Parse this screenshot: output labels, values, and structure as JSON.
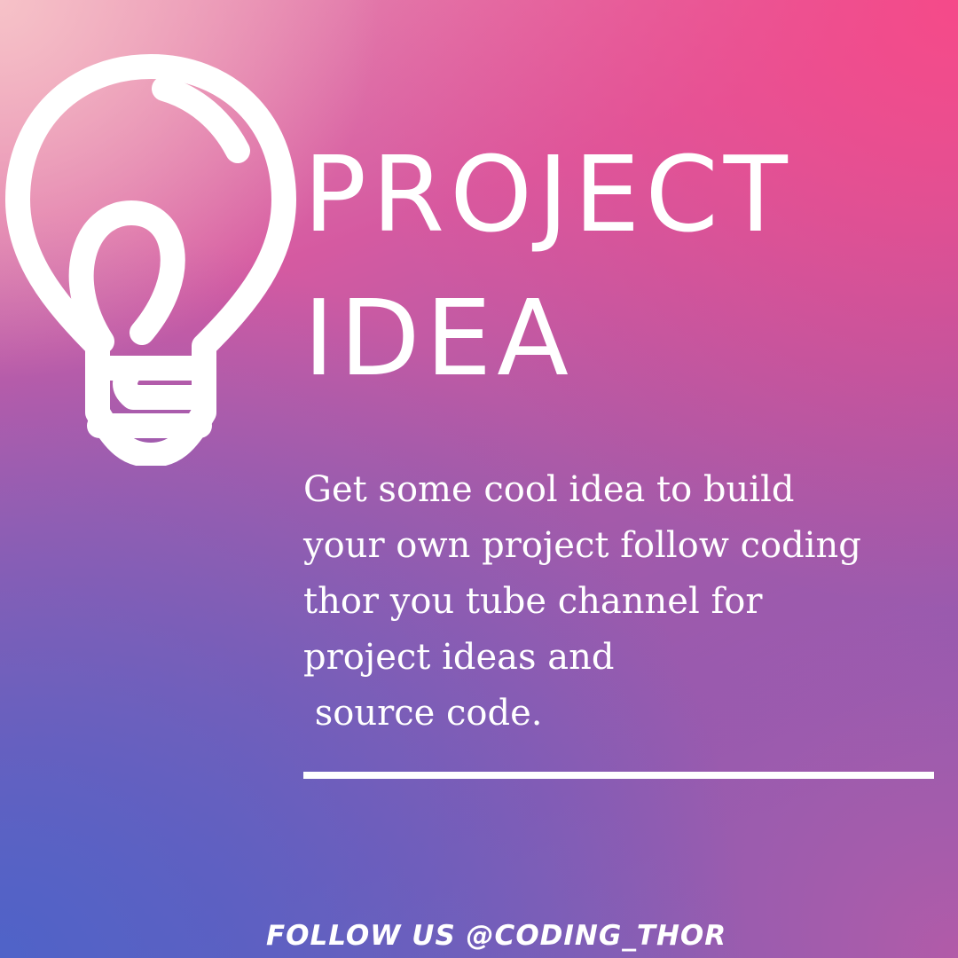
{
  "poster": {
    "icon": "lightbulb-icon",
    "title_line1": "PROJECT",
    "title_line2": "IDEA",
    "description_lines": [
      "Get some cool idea to build",
      "your own project follow coding",
      "thor you tube channel for",
      "project ideas and",
      " source code."
    ],
    "footer": "FOLLOW US @CODING_THOR",
    "colors": {
      "top_left": "#f6c2c8",
      "top_right": "#f54a89",
      "bottom_left": "#4f63c8",
      "text": "#ffffff"
    }
  }
}
